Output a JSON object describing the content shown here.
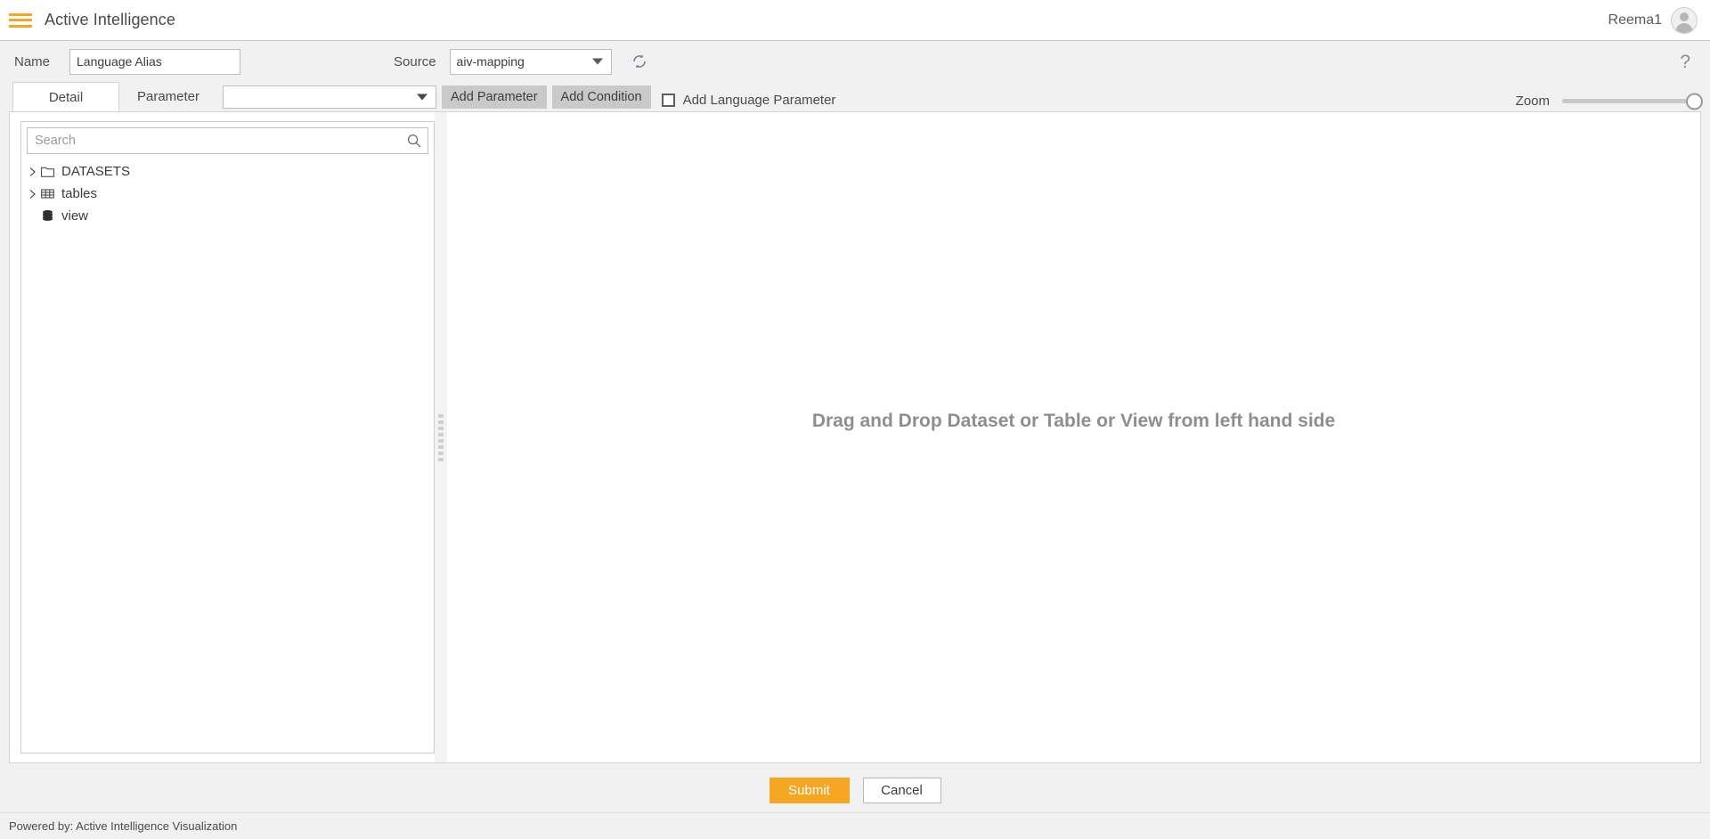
{
  "header": {
    "menu_icon": "hamburger-menu-icon",
    "title": "Active Intelligence",
    "user_name": "Reema1",
    "avatar_icon": "user-avatar-icon"
  },
  "meta_bar": {
    "name_label": "Name",
    "name_value": "Language Alias",
    "source_label": "Source",
    "source_value": "aiv-mapping",
    "refresh_icon": "refresh-icon",
    "help_icon": "help-question-icon"
  },
  "tabs": [
    {
      "label": "Detail",
      "active": true
    },
    {
      "label": "Parameter",
      "active": false
    }
  ],
  "toolbar": {
    "parameter_select_value": "",
    "add_parameter_label": "Add Parameter",
    "add_condition_label": "Add Condition",
    "add_language_parameter_label": "Add Language Parameter",
    "add_language_parameter_checked": false,
    "zoom_label": "Zoom",
    "zoom_value": 100
  },
  "left_panel": {
    "search_placeholder": "Search",
    "search_value": "",
    "search_icon": "search-icon",
    "tree": [
      {
        "label": "DATASETS",
        "icon": "folder-icon",
        "expandable": true
      },
      {
        "label": "tables",
        "icon": "table-grid-icon",
        "expandable": true
      },
      {
        "label": "view",
        "icon": "database-stack-icon",
        "expandable": false
      }
    ]
  },
  "canvas": {
    "empty_message": "Drag and Drop Dataset or Table or View from left hand side"
  },
  "actions": {
    "submit_label": "Submit",
    "cancel_label": "Cancel"
  },
  "footer": {
    "text": "Powered by: Active Intelligence Visualization"
  },
  "colors": {
    "accent_orange": "#F5A623",
    "panel_gray": "#F1F1F1",
    "button_gray": "#C9C9C9",
    "text_dark": "#4A4A4A",
    "placeholder_gray": "#8E8E8E"
  }
}
